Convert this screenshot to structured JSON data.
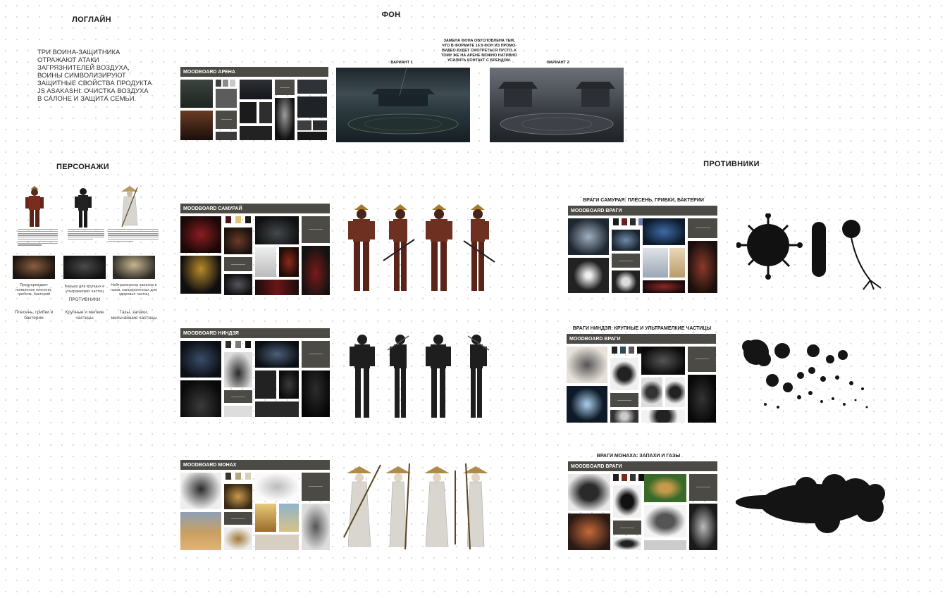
{
  "logline": {
    "title": "ЛОГЛАЙН",
    "text": "ТРИ ВОИНА-ЗАЩИТНИКА ОТРАЖАЮТ АТАКИ ЗАГРЯЗНИТЕЛЕЙ ВОЗДУХА, ВОИНЫ СИМВОЛИЗИРУЮТ ЗАЩИТНЫЕ СВОЙСТВА ПРОДУКТА JS ASAKASHI: ОЧИСТКА ВОЗДУХА В САЛОНЕ И ЗАЩИТА СЕМЬИ."
  },
  "background": {
    "title": "ФОН",
    "note": "ЗАМЕНА ФОНА ОБУСЛОВЛЕНА ТЕМ, ЧТО В ФОРМАТЕ 16:9 ФОН ИЗ ПРОМО-ВИДЕО БУДЕТ СМОТРЕТЬСЯ ПУСТО. К ТОМУ ЖЕ НА АРЕНЕ МОЖНО НАТИВНО УСИЛИТЬ КОНТАКТ С БРЕНДОМ.",
    "arena_header": "MOODBOARD АРЕНА",
    "variant1": "ВАРИАНТ 1",
    "variant2": "ВАРИАНТ 2"
  },
  "characters": {
    "title": "ПЕРСОНАЖИ",
    "captions": [
      "Предупреждает появление плесени, грибков, бактерий",
      "Барьер для крупных и ультрамелких частиц",
      "Нейтрализатор запахов и газов, канцерогенных для здоровья частиц"
    ],
    "enemies_label": "ПРОТИВНИКИ",
    "enemies": [
      "Плесень, грибки и бактерии",
      "Крупные и мелкие частицы",
      "Газы, запахи, мельчайшие частицы"
    ]
  },
  "moodboards": {
    "samurai": "MOODBOARD САМУРАЙ",
    "ninja": "MOODBOARD НИНДЗЯ",
    "monk": "MOODBOARD МОНАХ"
  },
  "opponents": {
    "title": "ПРОТИВНИКИ",
    "samurai_enemies": "ВРАГИ САМУРАЯ: ПЛЕСЕНЬ, ГРИБКИ, БАКТЕРИИ",
    "ninja_enemies": "ВРАГИ НИНДЗЯ: КРУПНЫЕ И УЛЬТРАМЕЛКИЕ ЧАСТИЦЫ",
    "monk_enemies": "ВРАГИ МОНАХА: ЗАПАХИ И ГАЗЫ",
    "mb_enemies_1": "MOODBOARD ВРАГИ",
    "mb_enemies_2": "MOODBOARD ВРАГИ",
    "mb_enemies_3": "MOODBOARD ВРАГИ"
  },
  "colors": {
    "header": "#4b4a45",
    "samurai_swatches": [
      "#4a1320",
      "#e3c27a",
      "#1a1a1a"
    ],
    "ninja_swatches": [
      "#2e2e2e",
      "#7a7a7a",
      "#111111"
    ],
    "monk_swatches": [
      "#3a332a",
      "#b8a47c",
      "#d8d0bf"
    ],
    "enemy1_swatches": [
      "#1a1a1a",
      "#6b1e1e",
      "#2b2b2b",
      "#6c7ea8"
    ],
    "enemy2_swatches": [
      "#222222",
      "#2f4a5a",
      "#555555",
      "#111111"
    ],
    "enemy3_swatches": [
      "#1f1f1f",
      "#7a2a1a",
      "#333333",
      "#0f0f0f"
    ]
  }
}
